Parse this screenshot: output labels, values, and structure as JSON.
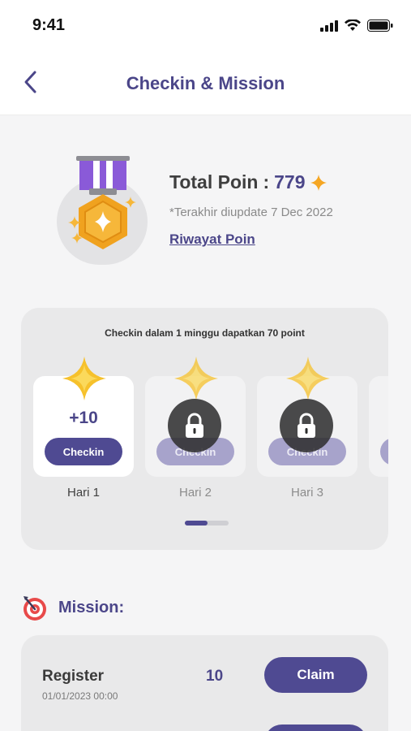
{
  "status_bar": {
    "time": "9:41"
  },
  "header": {
    "title": "Checkin & Mission"
  },
  "points": {
    "label": "Total Poin",
    "separator": ":",
    "value": "779",
    "updated": "*Terakhir diupdate 7 Dec 2022",
    "history_link": "Riwayat Poin"
  },
  "checkin": {
    "caption": "Checkin dalam 1 minggu dapatkan 70 point",
    "days": [
      {
        "label": "Hari 1",
        "points": "+10",
        "button": "Checkin",
        "locked": false
      },
      {
        "label": "Hari 2",
        "points": "",
        "button": "Checkin",
        "locked": true
      },
      {
        "label": "Hari 3",
        "points": "",
        "button": "Checkin",
        "locked": true
      }
    ],
    "pager": {
      "current": 1,
      "total": 2
    }
  },
  "mission": {
    "title": "Mission:",
    "items": [
      {
        "name": "Register",
        "date": "01/01/2023 00:00",
        "points": "10",
        "button": "Claim"
      }
    ]
  },
  "colors": {
    "primary": "#4f4a92",
    "primary_light": "#a7a3cb",
    "star": "#f5a623",
    "medal_ribbon": "#8a5ad8",
    "card_bg": "#e9e9ea"
  },
  "icons": [
    "back-arrow-icon",
    "signal-icon",
    "wifi-icon",
    "battery-icon",
    "medal-icon",
    "sparkle-icon",
    "star-icon",
    "lock-icon",
    "target-icon"
  ]
}
